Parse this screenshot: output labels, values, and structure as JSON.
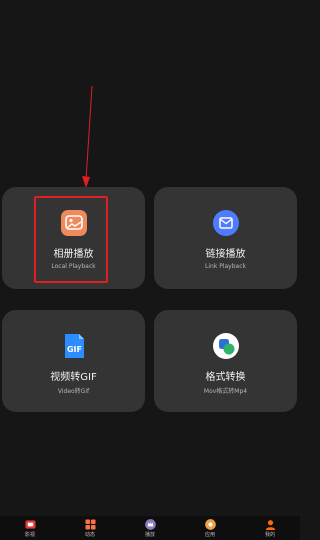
{
  "cards": [
    {
      "title": "相册播放",
      "subtitle": "Local Playback",
      "icon": "album-icon",
      "color": "#f08a5d"
    },
    {
      "title": "链接播放",
      "subtitle": "Link Playback",
      "icon": "link-icon",
      "color": "#4f7cff"
    },
    {
      "title": "视频转GIF",
      "subtitle": "Video转Gif",
      "icon": "gif-icon",
      "color": "#2d8cff"
    },
    {
      "title": "格式转换",
      "subtitle": "Mov格式转Mp4",
      "icon": "format-convert-icon",
      "color": "#3a7bd5"
    }
  ],
  "tabs": [
    {
      "label": "影视",
      "icon": "film-icon",
      "color": "#e53935"
    },
    {
      "label": "动态",
      "icon": "grid-icon",
      "color": "#ff7043"
    },
    {
      "label": "播放",
      "icon": "crown-icon",
      "color": "#8e7cc3"
    },
    {
      "label": "应用",
      "icon": "apps-icon",
      "color": "#f0a045"
    },
    {
      "label": "我的",
      "icon": "profile-icon",
      "color": "#ff6d00"
    }
  ],
  "accent": "#e02020"
}
